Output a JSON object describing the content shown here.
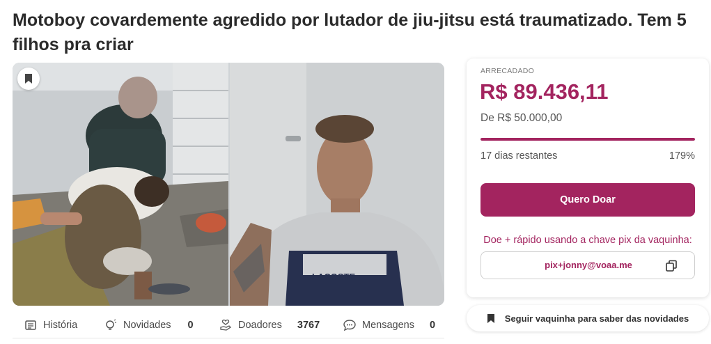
{
  "page": {
    "title": "Motoboy covardemente agredido por lutador de jiu-jitsu está traumatizado. Tem 5 filhos pra criar"
  },
  "media": {
    "left_image_icon": "photo-assault-scene",
    "right_image_icon": "photo-man-portrait",
    "shirt_text": "LACOSTE",
    "bookmark_icon": "bookmark-icon"
  },
  "tabs": [
    {
      "label": "História",
      "icon": "document-icon"
    },
    {
      "label": "Novidades",
      "icon": "lightbulb-icon",
      "count": "0"
    },
    {
      "label": "Doadores",
      "icon": "hand-heart-icon",
      "count": "3767"
    },
    {
      "label": "Mensagens",
      "icon": "chat-icon",
      "count": "0"
    }
  ],
  "card": {
    "raised_label": "ARRECADADO",
    "raised_amount": "R$ 89.436,11",
    "goal_text": "De R$ 50.000,00",
    "progress": 1.0,
    "days_left": "17 dias restantes",
    "percent": "179%",
    "donate_label": "Quero Doar",
    "pix_prompt": "Doe + rápido usando a chave pix da vaquinha:",
    "pix_key": "pix+jonny@voaa.me",
    "copy_icon": "copy-icon"
  },
  "follow": {
    "label": "Seguir vaquinha para saber das novidades",
    "icon": "bookmark-icon"
  },
  "colors": {
    "accent": "#a3245f",
    "text": "#2b2b2b",
    "muted": "#555555"
  }
}
